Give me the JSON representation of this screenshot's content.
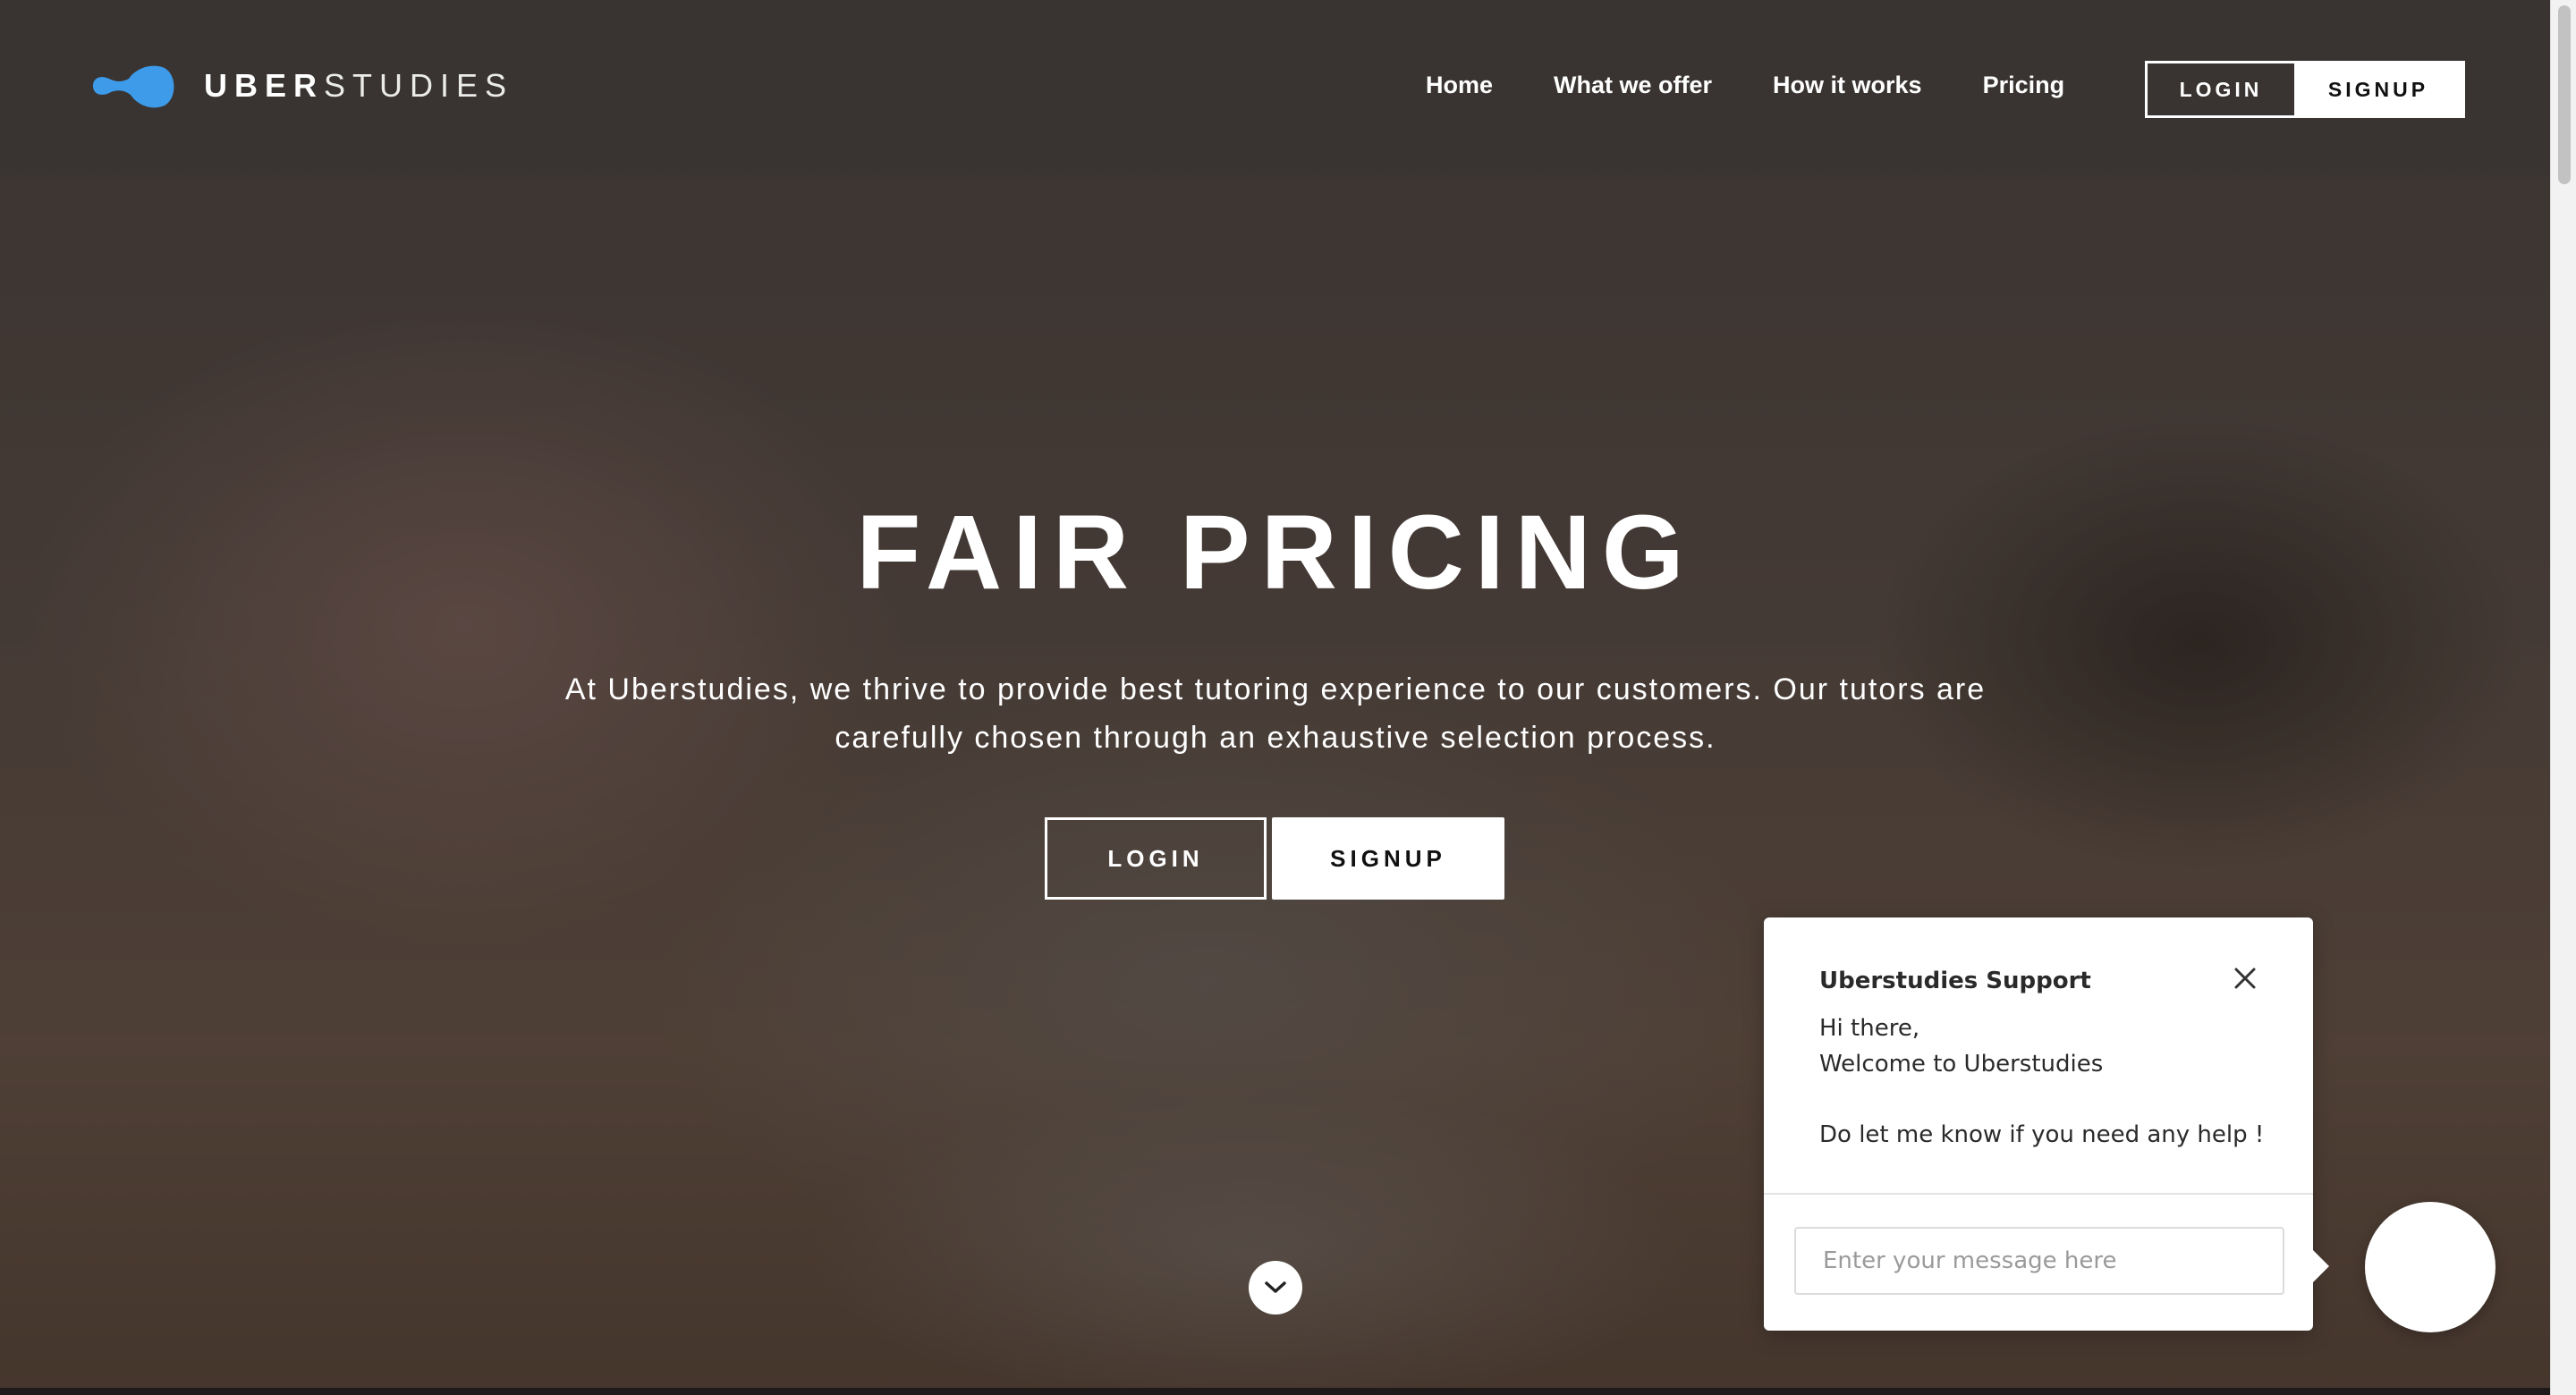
{
  "brand": {
    "name_bold": "UBER",
    "name_light": "STUDIES",
    "logo_icon": "blob-logo-icon",
    "accent_color": "#3d9be9"
  },
  "nav": {
    "items": [
      {
        "label": "Home"
      },
      {
        "label": "What we offer"
      },
      {
        "label": "How it works"
      },
      {
        "label": "Pricing"
      }
    ],
    "login_label": "LOGIN",
    "signup_label": "SIGNUP"
  },
  "hero": {
    "title": "FAIR PRICING",
    "description": "At Uberstudies, we thrive to provide best tutoring experience to our customers. Our tutors are carefully chosen through an exhaustive selection process.",
    "login_label": "LOGIN",
    "signup_label": "SIGNUP",
    "scroll_icon": "chevron-down-icon"
  },
  "chat": {
    "title": "Uberstudies Support",
    "greeting_line1": "Hi there,",
    "greeting_line2": "Welcome to Uberstudies",
    "help_text": "Do let me know if you need any help !",
    "input_placeholder": "Enter your message here",
    "close_icon": "close-icon"
  }
}
